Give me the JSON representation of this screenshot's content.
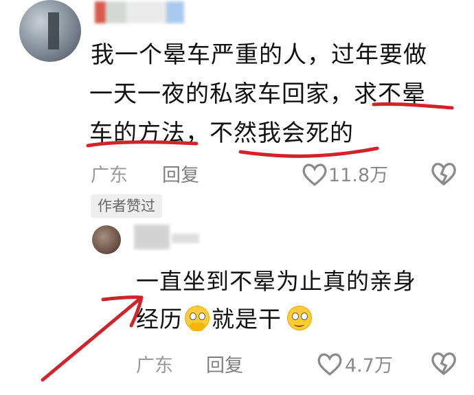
{
  "comment1": {
    "line1": "我一个晕车严重的人，过年要做",
    "line2": "一天一夜的私家车回家，求不晕",
    "line3": "车的方法，不然我会死的",
    "location": "广东",
    "reply_label": "回复",
    "like_count": "11.8万"
  },
  "author_badge": "作者赞过",
  "reply1": {
    "line1": "一直坐到不晕为止真的亲身",
    "line2_prefix": "经历",
    "line2_middle": "就是干",
    "emoji_1": "pleading-face-icon",
    "emoji_2": "smiling-face-icon",
    "location": "广东",
    "reply_label": "回复",
    "like_count": "4.7万"
  },
  "colors": {
    "underline": "#d2232a",
    "arrow": "#d2232a",
    "meta_text": "#9a9a9a",
    "badge_bg": "#eeeeee"
  }
}
